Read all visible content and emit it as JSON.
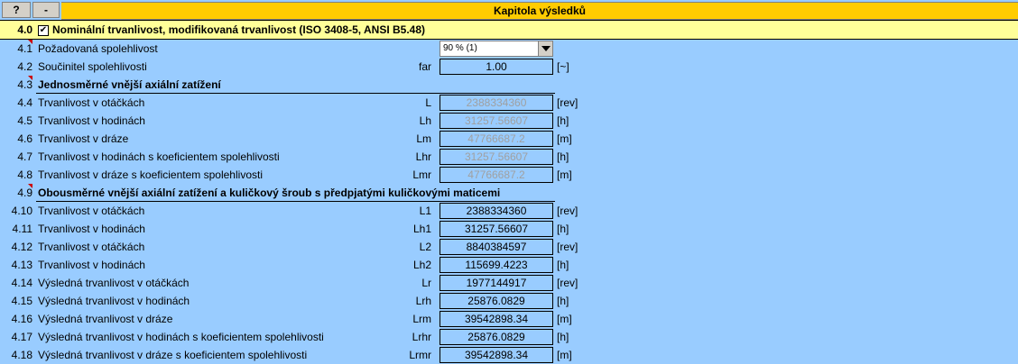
{
  "header": {
    "help_label": "?",
    "collapse_label": "-",
    "chapter_title": "Kapitola výsledků"
  },
  "section": {
    "number": "4.0",
    "checked": "✔",
    "title": "Nominální trvanlivost, modifikovaná trvanlivost (ISO 3408-5, ANSI B5.48)"
  },
  "rows": [
    {
      "num": "4.1",
      "label": "Požadovaná spolehlivost",
      "sym": "",
      "value": "90 % (1)",
      "unit": ""
    },
    {
      "num": "4.2",
      "label": "Součinitel spolehlivosti",
      "sym": "far",
      "value": "1.00",
      "unit": "[~]"
    },
    {
      "num": "4.3",
      "label": "Jednosměrné vnější axiální zatížení",
      "sym": "",
      "value": "",
      "unit": ""
    },
    {
      "num": "4.4",
      "label": "Trvanlivost v otáčkách",
      "sym": "L",
      "value": "2388334360",
      "unit": "[rev]"
    },
    {
      "num": "4.5",
      "label": "Trvanlivost v hodinách",
      "sym": "Lh",
      "value": "31257.56607",
      "unit": "[h]"
    },
    {
      "num": "4.6",
      "label": "Trvanlivost v dráze",
      "sym": "Lm",
      "value": "47766687.2",
      "unit": "[m]"
    },
    {
      "num": "4.7",
      "label": "Trvanlivost v hodinách s koeficientem spolehlivosti",
      "sym": "Lhr",
      "value": "31257.56607",
      "unit": "[h]"
    },
    {
      "num": "4.8",
      "label": "Trvanlivost v dráze s koeficientem spolehlivosti",
      "sym": "Lmr",
      "value": "47766687.2",
      "unit": "[m]"
    },
    {
      "num": "4.9",
      "label": "Obousměrné vnější axiální zatížení a kuličkový šroub s předpjatými kuličkovými maticemi",
      "sym": "",
      "value": "",
      "unit": ""
    },
    {
      "num": "4.10",
      "label": "Trvanlivost v otáčkách",
      "sym": "L1",
      "value": "2388334360",
      "unit": "[rev]"
    },
    {
      "num": "4.11",
      "label": "Trvanlivost v hodinách",
      "sym": "Lh1",
      "value": "31257.56607",
      "unit": "[h]"
    },
    {
      "num": "4.12",
      "label": "Trvanlivost v otáčkách",
      "sym": "L2",
      "value": "8840384597",
      "unit": "[rev]"
    },
    {
      "num": "4.13",
      "label": "Trvanlivost v hodinách",
      "sym": "Lh2",
      "value": "115699.4223",
      "unit": "[h]"
    },
    {
      "num": "4.14",
      "label": "Výsledná trvanlivost v otáčkách",
      "sym": "Lr",
      "value": "1977144917",
      "unit": "[rev]"
    },
    {
      "num": "4.15",
      "label": "Výsledná trvanlivost v hodinách",
      "sym": "Lrh",
      "value": "25876.0829",
      "unit": "[h]"
    },
    {
      "num": "4.16",
      "label": "Výsledná trvanlivost v dráze",
      "sym": "Lrm",
      "value": "39542898.34",
      "unit": "[m]"
    },
    {
      "num": "4.17",
      "label": "Výsledná trvanlivost v hodinách s koeficientem spolehlivosti",
      "sym": "Lrhr",
      "value": "25876.0829",
      "unit": "[h]"
    },
    {
      "num": "4.18",
      "label": "Výsledná trvanlivost v dráze s koeficientem spolehlivosti",
      "sym": "Lrmr",
      "value": "39542898.34",
      "unit": "[m]"
    }
  ]
}
